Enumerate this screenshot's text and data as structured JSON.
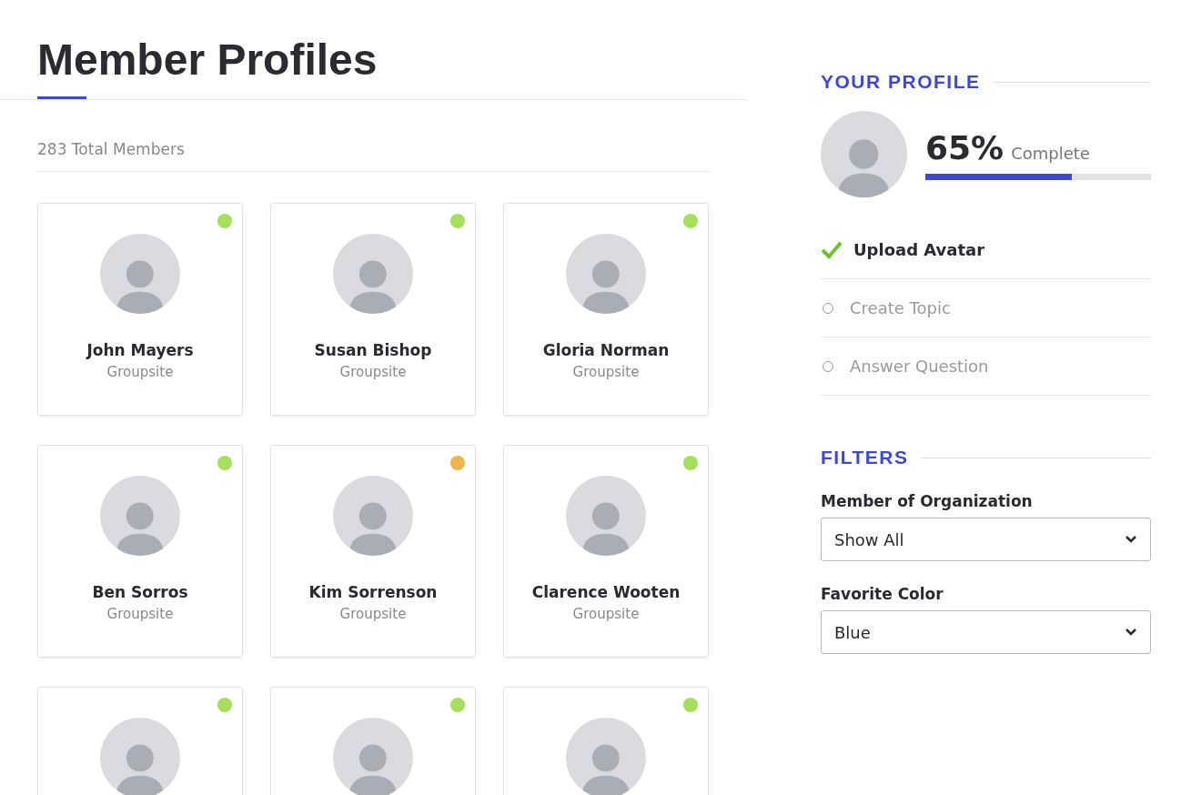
{
  "page": {
    "title": "Member Profiles",
    "total": "283 Total Members"
  },
  "members": [
    {
      "name": "John Mayers",
      "group": "Groupsite",
      "color": "#a6e05a"
    },
    {
      "name": "Susan Bishop",
      "group": "Groupsite",
      "color": "#a6e05a"
    },
    {
      "name": "Gloria Norman",
      "group": "Groupsite",
      "color": "#a6e05a"
    },
    {
      "name": "Ben Sorros",
      "group": "Groupsite",
      "color": "#a6e05a"
    },
    {
      "name": "Kim Sorrenson",
      "group": "Groupsite",
      "color": "#f0b54a"
    },
    {
      "name": "Clarence Wooten",
      "group": "Groupsite",
      "color": "#a6e05a"
    },
    {
      "color": "#a6e05a"
    },
    {
      "color": "#a6e05a"
    },
    {
      "color": "#a6e05a"
    }
  ],
  "profile": {
    "heading": "YOUR PROFILE",
    "percent": "65%",
    "complete": "Complete",
    "level": 0.65,
    "tasks": [
      {
        "label": "Upload Avatar",
        "checked": true
      },
      {
        "label": "Create Topic",
        "checked": false
      },
      {
        "label": "Answer Question",
        "checked": false
      }
    ]
  },
  "filters": {
    "heading": "FILTERS",
    "fields": [
      {
        "label": "Member of Organization",
        "value": "Show All"
      },
      {
        "label": "Favorite Color",
        "value": "Blue"
      }
    ]
  }
}
